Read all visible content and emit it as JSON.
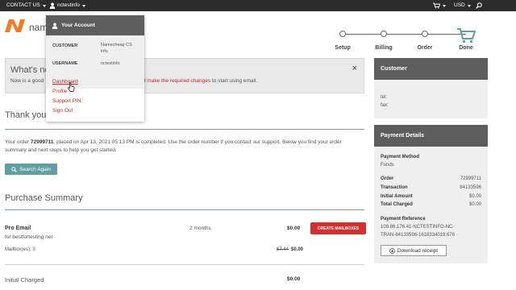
{
  "topbar": {
    "contact_us": "CONTACT US",
    "username": "nctestinfo",
    "currency": "USD"
  },
  "logo": {
    "partial_text": "name"
  },
  "steps": [
    {
      "label": "Setup"
    },
    {
      "label": "Billing"
    },
    {
      "label": "Order"
    },
    {
      "label": "Done"
    }
  ],
  "account_menu": {
    "title": "Your Account",
    "customer_label": "CUSTOMER",
    "customer_value_line1": "Namecheap CS",
    "customer_value_line2": "info",
    "username_label": "USERNAME",
    "username_value": "nctestinfo",
    "links": [
      "Dashboard",
      "Profile",
      "Support PIN",
      "Sign Out"
    ]
  },
  "notice": {
    "title_partial": "What's ne",
    "text_start": "Now is a good",
    "text_link1": "n",
    "text_and": " and ",
    "text_link2": "make the required changes",
    "text_end": " to start using email."
  },
  "main": {
    "thanks_partial": "Thank you",
    "order_text_prefix": "Your order ",
    "order_number": "72999711",
    "order_text_suffix": ", placed on Apr 13, 2021 05:13 PM is completed. Use the order number if you contact our support. Below you find your order summary and next steps to help you get started.",
    "search_again": "Search Again",
    "purchase_summary": "Purchase Summary",
    "item": {
      "name": "Pro Email",
      "domain": "for bestfortesting.net",
      "duration": "2 months",
      "price": "$0.00",
      "create_button": "CREATE MAILBOXES",
      "mailbox_label": "Mailbox(es): 3",
      "old_price": "$7.44",
      "new_price": "$0.00"
    },
    "initial_charged_label": "Initial Charged",
    "initial_charged_value": "$0.00"
  },
  "customer_panel": {
    "title": "Customer",
    "tel_label": "tel:",
    "fax_label": "fax:"
  },
  "payment_panel": {
    "title": "Payment Details",
    "method_label": "Payment Method",
    "method_value": "Funds",
    "rows": [
      {
        "label": "Order",
        "value": "72999711"
      },
      {
        "label": "Transaction",
        "value": "84133596"
      },
      {
        "label": "Initial Amount",
        "value": "$0.00"
      },
      {
        "label": "Total Charged",
        "value": "$0.00"
      }
    ],
    "reference_label": "Payment Reference",
    "reference_line1": "109.86.176.41-NCTESTINFO-NC-",
    "reference_line2": "TRAN-84133596-1618334019.676",
    "download_button": "Download receipt"
  },
  "colors": {
    "topbar_bg": "#2c2c2c",
    "accent_red": "#d32f2f",
    "link_red": "#c62828",
    "teal_button": "#5f9ea4",
    "panel_header": "#5d5d5d",
    "logo_orange": "#f47b20"
  }
}
